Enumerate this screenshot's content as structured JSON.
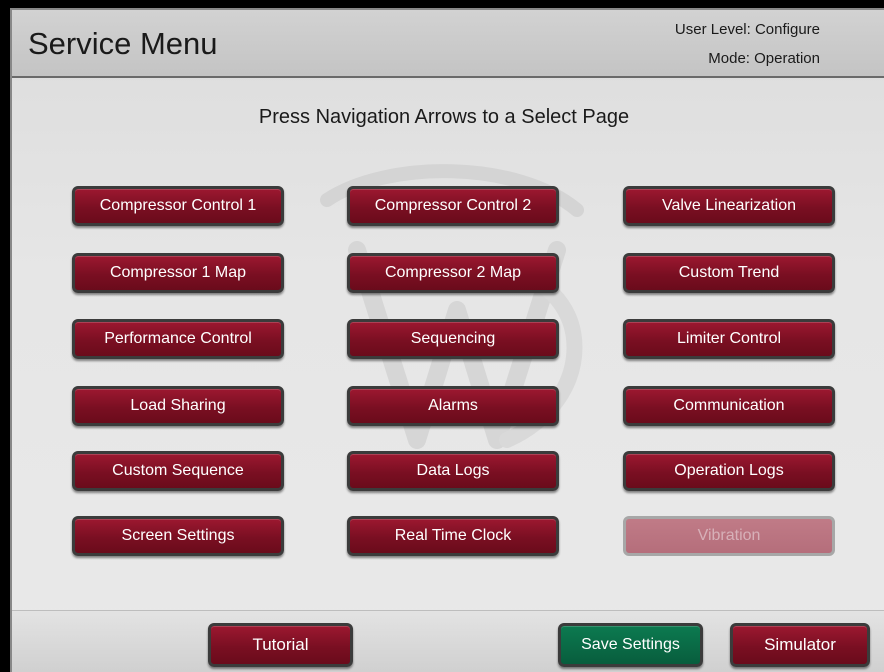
{
  "header": {
    "title": "Service Menu",
    "user_level": "User Level: Configure",
    "mode": "Mode: Operation"
  },
  "instruction": "Press Navigation Arrows to a Select Page",
  "menu": {
    "compressor_control_1": "Compressor Control 1",
    "compressor_control_2": "Compressor Control 2",
    "valve_linearization": "Valve Linearization",
    "compressor_1_map": "Compressor 1 Map",
    "compressor_2_map": "Compressor 2 Map",
    "custom_trend": "Custom Trend",
    "performance_control": "Performance Control",
    "sequencing": "Sequencing",
    "limiter_control": "Limiter Control",
    "load_sharing": "Load Sharing",
    "alarms": "Alarms",
    "communication": "Communication",
    "custom_sequence": "Custom Sequence",
    "data_logs": "Data Logs",
    "operation_logs": "Operation Logs",
    "screen_settings": "Screen Settings",
    "real_time_clock": "Real Time Clock",
    "vibration": "Vibration"
  },
  "footer": {
    "tutorial": "Tutorial",
    "save_settings": "Save Settings",
    "simulator": "Simulator"
  },
  "colors": {
    "button_red": "#7a0f22",
    "button_disabled": "#b56e7b",
    "button_green": "#085d3d",
    "background": "#e6e6e6"
  }
}
